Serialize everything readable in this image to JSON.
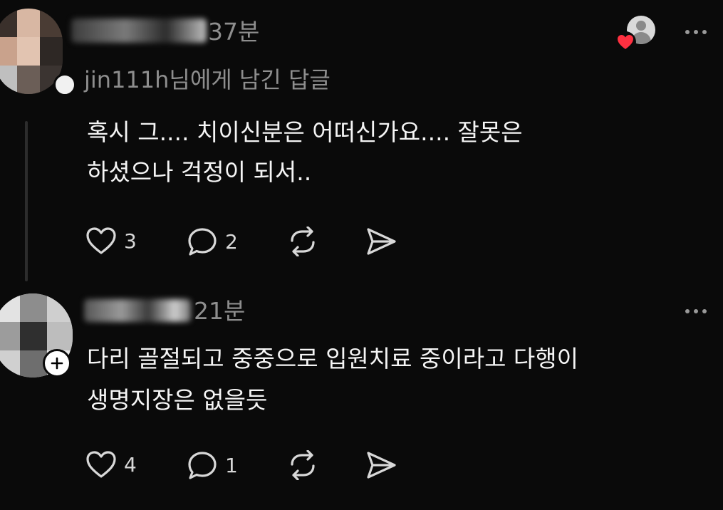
{
  "comments": [
    {
      "time": "37분",
      "reply_to": "jin111h님에게 남긴 답글",
      "text_line1": "혹시 그.... 치이신분은 어떠신가요.... 잘못은",
      "text_line2": "하셨으나 걱정이 되서..",
      "likes": "3",
      "replies": "2"
    },
    {
      "time": "21분",
      "text_line1": "다리 골절되고 중중으로 입원치료 중이라고 다행이",
      "text_line2": "생명지장은 없을듯",
      "likes": "4",
      "replies": "1"
    }
  ],
  "icons": {
    "like": "heart-outline-icon",
    "reply": "speech-bubble-icon",
    "repost": "repost-icon",
    "share": "send-icon",
    "more": "more-horizontal-icon",
    "liked_badge": "heart-filled-icon",
    "follow": "plus-icon"
  },
  "colors": {
    "background": "#0a0a0a",
    "text": "#f5f5f5",
    "muted": "#8e8e8e",
    "heart": "#ff3040"
  }
}
